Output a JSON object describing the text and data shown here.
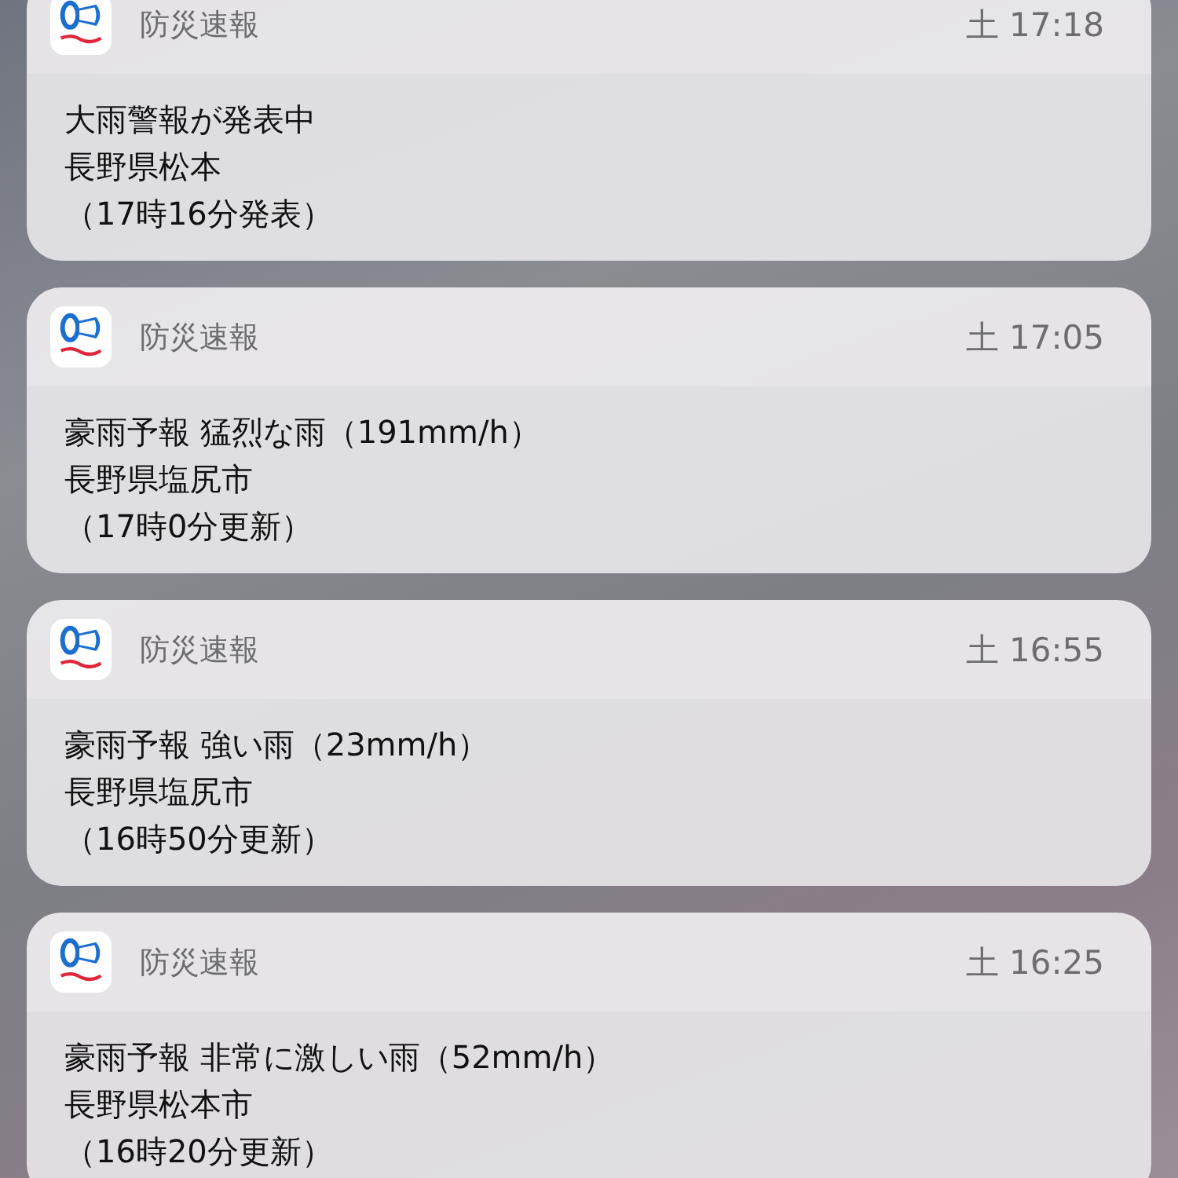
{
  "notifications": [
    {
      "app": "防災速報",
      "time": "土 17:18",
      "lines": [
        "大雨警報が発表中",
        "長野県松本",
        "（17時16分発表）"
      ]
    },
    {
      "app": "防災速報",
      "time": "土 17:05",
      "lines": [
        "豪雨予報 猛烈な雨（191mm/h）",
        "長野県塩尻市",
        "（17時0分更新）"
      ]
    },
    {
      "app": "防災速報",
      "time": "土 16:55",
      "lines": [
        "豪雨予報 強い雨（23mm/h）",
        "長野県塩尻市",
        "（16時50分更新）"
      ]
    },
    {
      "app": "防災速報",
      "time": "土 16:25",
      "lines": [
        "豪雨予報 非常に激しい雨（52mm/h）",
        "長野県松本市",
        "（16時20分更新）"
      ]
    }
  ]
}
